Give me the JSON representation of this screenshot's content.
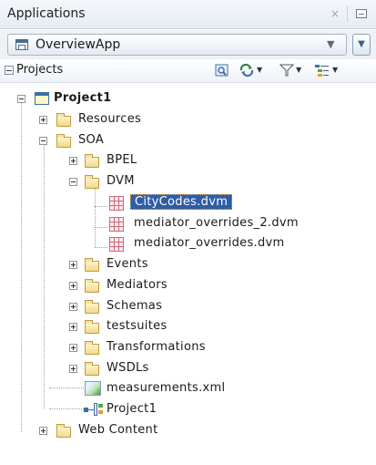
{
  "panel": {
    "title": "Applications",
    "close_glyph": "×"
  },
  "application": {
    "selected": "OverviewApp",
    "caret_glyph": "▼",
    "menu_glyph": "▼"
  },
  "projects_bar": {
    "label": "Projects",
    "toolbar_icons": [
      "search-icon",
      "refresh-icon",
      "filter-icon",
      "view-options-icon"
    ],
    "dropdown_glyph": "▼"
  },
  "tree": {
    "root": "Project1",
    "items": {
      "resources": "Resources",
      "soa": "SOA",
      "bpel": "BPEL",
      "dvm": "DVM",
      "citycodes": "CityCodes.dvm",
      "mediator_overrides_2": "mediator_overrides_2.dvm",
      "mediator_overrides": "mediator_overrides.dvm",
      "events": "Events",
      "mediators": "Mediators",
      "schemas": "Schemas",
      "testsuites": "testsuites",
      "transformations": "Transformations",
      "wsdls": "WSDLs",
      "measurements": "measurements.xml",
      "composite": "Project1",
      "web_content": "Web Content"
    }
  },
  "colors": {
    "selection": "#2f5da6",
    "folder": "#f1d98e"
  }
}
